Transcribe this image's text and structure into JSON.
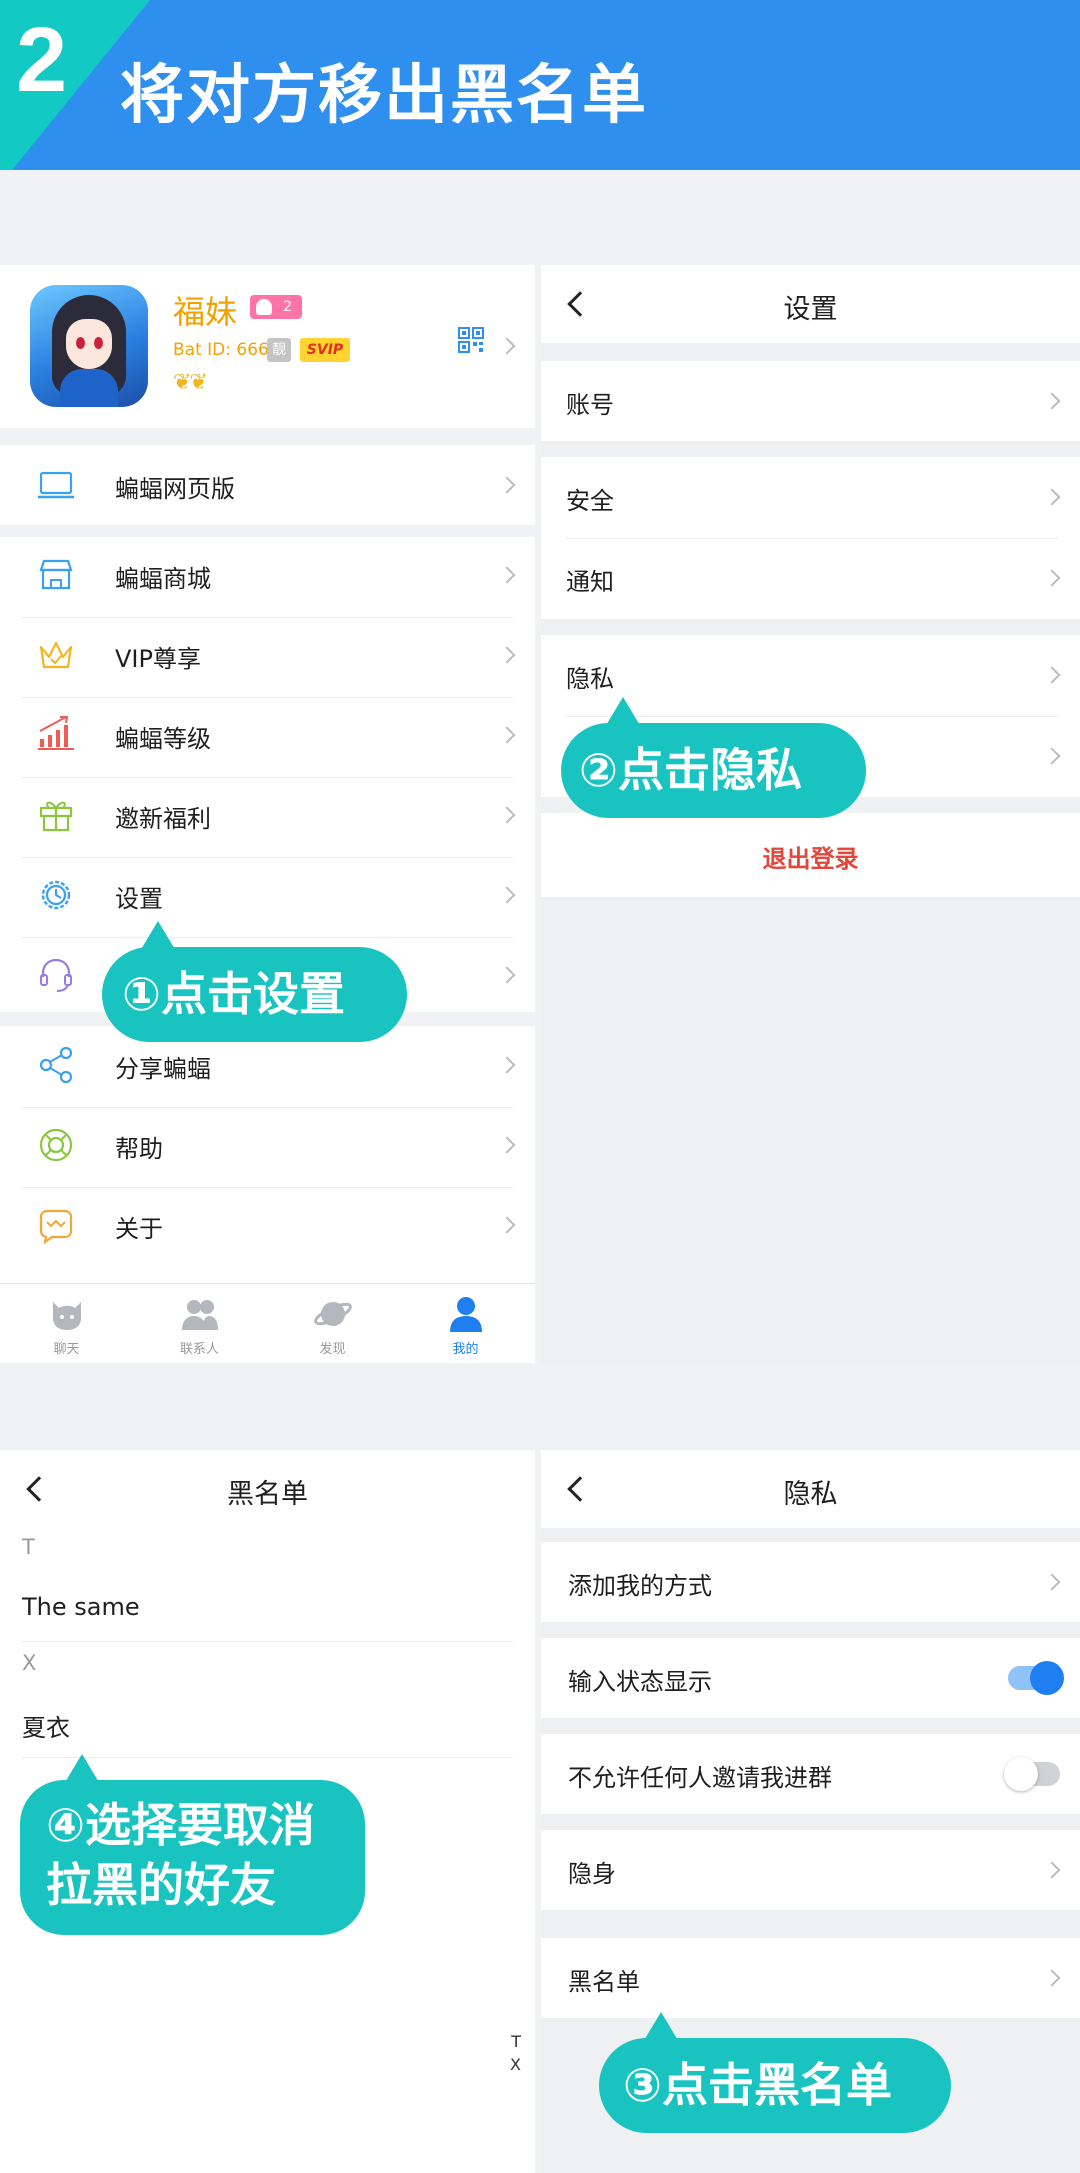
{
  "banner": {
    "step": "2",
    "title": "将对方移出黑名单"
  },
  "profile": {
    "name": "福妹",
    "badge_count": "2",
    "bat_id": "Bat ID: 666",
    "liang": "靓",
    "svip": "SVIP",
    "wings": "❦❦"
  },
  "me_menu": {
    "web": "蝙蝠网页版",
    "mall": "蝙蝠商城",
    "vip": "VIP尊享",
    "level": "蝙蝠等级",
    "invite": "邀新福利",
    "settings": "设置",
    "share": "分享蝙蝠",
    "help": "帮助",
    "about": "关于"
  },
  "tabs": [
    {
      "label": "聊天"
    },
    {
      "label": "联系人"
    },
    {
      "label": "发现"
    },
    {
      "label": "我的"
    }
  ],
  "settings_screen": {
    "title": "设置",
    "account": "账号",
    "security": "安全",
    "notify": "通知",
    "privacy": "隐私",
    "logout": "退出登录"
  },
  "privacy_screen": {
    "title": "隐私",
    "add_me": "添加我的方式",
    "typing_status": "输入状态显示",
    "typing_on": true,
    "no_invite": "不允许任何人邀请我进群",
    "no_invite_on": false,
    "stealth": "隐身",
    "blacklist": "黑名单"
  },
  "blacklist_screen": {
    "title": "黑名单",
    "sections": [
      {
        "letter": "T",
        "name": "The same"
      },
      {
        "letter": "X",
        "name": "夏衣"
      }
    ],
    "index": [
      "T",
      "X"
    ]
  },
  "callouts": {
    "step1": "①点击设置",
    "step2": "②点击隐私",
    "step3": "③点击黑名单",
    "step4_line1": "④选择要取消",
    "step4_line2": "拉黑的好友"
  },
  "colors": {
    "banner_blue": "#2e8fee",
    "banner_teal": "#12c9c4",
    "callout_teal": "#19c4c0",
    "accent_blue": "#1f7ff0",
    "logout_red": "#e4473a",
    "profile_gold": "#f2a100"
  }
}
